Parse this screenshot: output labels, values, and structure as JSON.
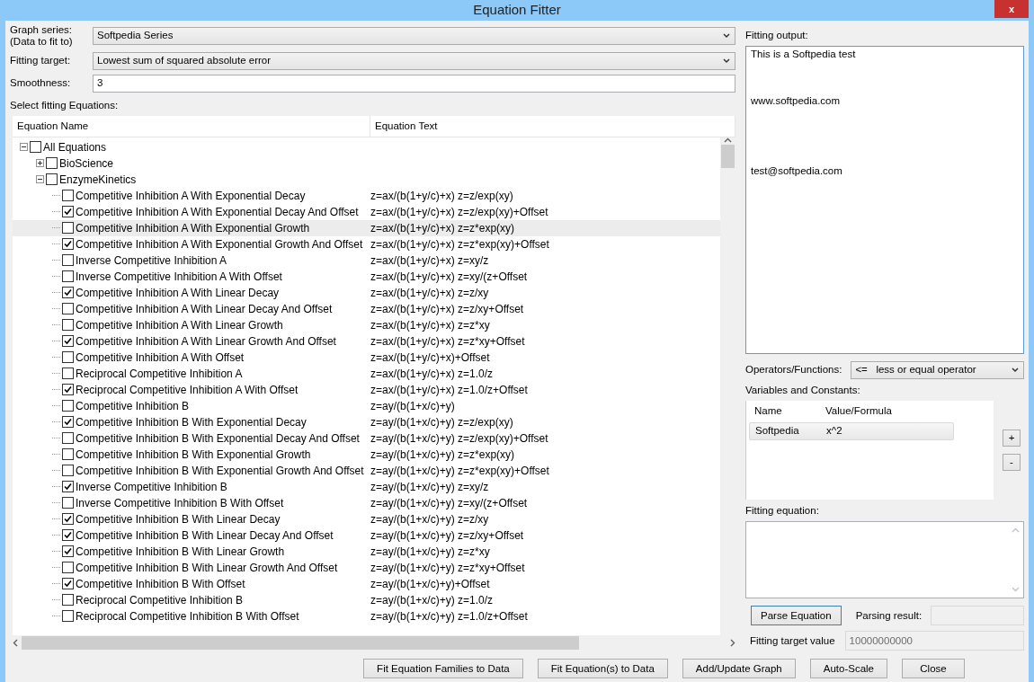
{
  "window": {
    "title": "Equation Fitter",
    "close_label": "x"
  },
  "form": [
    {
      "kind": "select",
      "label": "Graph series:\n(Data to fit to)",
      "value": "Softpedia Series"
    },
    {
      "kind": "select",
      "label": "Fitting target:",
      "value": "Lowest sum of squared absolute error"
    },
    {
      "kind": "input",
      "label": "Smoothness:",
      "value": "3"
    }
  ],
  "equations": {
    "label": "Select fitting Equations:",
    "columns": [
      "Equation Name",
      "Equation Text"
    ],
    "tree": [
      {
        "name": "All Equations",
        "checked": false,
        "expanded": true,
        "children": [
          {
            "name": "BioScience",
            "checked": false,
            "expanded": false
          },
          {
            "name": "EnzymeKinetics",
            "checked": false,
            "expanded": true,
            "children": [
              {
                "name": "Competitive Inhibition A With Exponential Decay",
                "text": "z=ax/(b(1+y/c)+x) z=z/exp(xy)",
                "checked": false,
                "selected": false
              },
              {
                "name": "Competitive Inhibition A With Exponential Decay And Offset",
                "text": "z=ax/(b(1+y/c)+x) z=z/exp(xy)+Offset",
                "checked": true,
                "selected": false
              },
              {
                "name": "Competitive Inhibition A With Exponential Growth",
                "text": "z=ax/(b(1+y/c)+x) z=z*exp(xy)",
                "checked": false,
                "selected": true
              },
              {
                "name": "Competitive Inhibition A With Exponential Growth And Offset",
                "text": "z=ax/(b(1+y/c)+x) z=z*exp(xy)+Offset",
                "checked": true,
                "selected": false
              },
              {
                "name": "Inverse Competitive Inhibition A",
                "text": "z=ax/(b(1+y/c)+x) z=xy/z",
                "checked": false,
                "selected": false
              },
              {
                "name": "Inverse Competitive Inhibition A With Offset",
                "text": "z=ax/(b(1+y/c)+x) z=xy/(z+Offset",
                "checked": false,
                "selected": false
              },
              {
                "name": "Competitive Inhibition A With Linear Decay",
                "text": "z=ax/(b(1+y/c)+x) z=z/xy",
                "checked": true,
                "selected": false
              },
              {
                "name": "Competitive Inhibition A With Linear Decay And Offset",
                "text": "z=ax/(b(1+y/c)+x) z=z/xy+Offset",
                "checked": false,
                "selected": false
              },
              {
                "name": "Competitive Inhibition A With Linear Growth",
                "text": "z=ax/(b(1+y/c)+x) z=z*xy",
                "checked": false,
                "selected": false
              },
              {
                "name": "Competitive Inhibition A With Linear Growth And Offset",
                "text": "z=ax/(b(1+y/c)+x) z=z*xy+Offset",
                "checked": true,
                "selected": false
              },
              {
                "name": "Competitive Inhibition A With Offset",
                "text": "z=ax/(b(1+y/c)+x)+Offset",
                "checked": false,
                "selected": false
              },
              {
                "name": "Reciprocal Competitive Inhibition A",
                "text": "z=ax/(b(1+y/c)+x) z=1.0/z",
                "checked": false,
                "selected": false
              },
              {
                "name": "Reciprocal Competitive Inhibition A With Offset",
                "text": "z=ax/(b(1+y/c)+x) z=1.0/z+Offset",
                "checked": true,
                "selected": false
              },
              {
                "name": "Competitive Inhibition B",
                "text": "z=ay/(b(1+x/c)+y)",
                "checked": false,
                "selected": false
              },
              {
                "name": "Competitive Inhibition B With Exponential Decay",
                "text": "z=ay/(b(1+x/c)+y) z=z/exp(xy)",
                "checked": true,
                "selected": false
              },
              {
                "name": "Competitive Inhibition B With Exponential Decay And Offset",
                "text": "z=ay/(b(1+x/c)+y) z=z/exp(xy)+Offset",
                "checked": false,
                "selected": false
              },
              {
                "name": "Competitive Inhibition B With Exponential Growth",
                "text": "z=ay/(b(1+x/c)+y) z=z*exp(xy)",
                "checked": false,
                "selected": false
              },
              {
                "name": "Competitive Inhibition B With Exponential Growth And Offset",
                "text": "z=ay/(b(1+x/c)+y) z=z*exp(xy)+Offset",
                "checked": false,
                "selected": false
              },
              {
                "name": "Inverse Competitive Inhibition B",
                "text": "z=ay/(b(1+x/c)+y) z=xy/z",
                "checked": true,
                "selected": false
              },
              {
                "name": "Inverse Competitive Inhibition B With Offset",
                "text": "z=ay/(b(1+x/c)+y) z=xy/(z+Offset",
                "checked": false,
                "selected": false
              },
              {
                "name": "Competitive Inhibition B With Linear Decay",
                "text": "z=ay/(b(1+x/c)+y) z=z/xy",
                "checked": true,
                "selected": false
              },
              {
                "name": "Competitive Inhibition B With Linear Decay And Offset",
                "text": "z=ay/(b(1+x/c)+y) z=z/xy+Offset",
                "checked": true,
                "selected": false
              },
              {
                "name": "Competitive Inhibition B With Linear Growth",
                "text": "z=ay/(b(1+x/c)+y) z=z*xy",
                "checked": true,
                "selected": false
              },
              {
                "name": "Competitive Inhibition B With Linear Growth And Offset",
                "text": "z=ay/(b(1+x/c)+y) z=z*xy+Offset",
                "checked": false,
                "selected": false
              },
              {
                "name": "Competitive Inhibition B With Offset",
                "text": "z=ay/(b(1+x/c)+y)+Offset",
                "checked": true,
                "selected": false
              },
              {
                "name": "Reciprocal Competitive Inhibition B",
                "text": "z=ay/(b(1+x/c)+y) z=1.0/z",
                "checked": false,
                "selected": false
              },
              {
                "name": "Reciprocal Competitive Inhibition B With Offset",
                "text": "z=ay/(b(1+x/c)+y) z=1.0/z+Offset",
                "checked": false,
                "selected": false
              }
            ]
          }
        ]
      }
    ]
  },
  "fitting_output": {
    "label": "Fitting output:",
    "text": "This is a Softpedia test\n\n\n\nwww.softpedia.com\n\n\n\n\n\ntest@softpedia.com"
  },
  "operators": {
    "label": "Operators/Functions:",
    "value": "<=   less or equal operator"
  },
  "variables": {
    "label": "Variables and Constants:",
    "columns": [
      "Name",
      "Value/Formula"
    ],
    "rows": [
      {
        "cells": [
          "Softpedia",
          "x^2"
        ],
        "selected": true
      }
    ],
    "add_label": "+",
    "remove_label": "-"
  },
  "fitting_equation": {
    "label": "Fitting equation:"
  },
  "parse": {
    "button": "Parse Equation",
    "result_label": "Parsing result:"
  },
  "target_value": {
    "label": "Fitting target value",
    "value": "10000000000",
    "disabled": true
  },
  "buttons": [
    "Fit Equation Families to Data",
    "Fit Equation(s) to Data",
    "Add/Update Graph",
    "Auto-Scale",
    "Close"
  ]
}
